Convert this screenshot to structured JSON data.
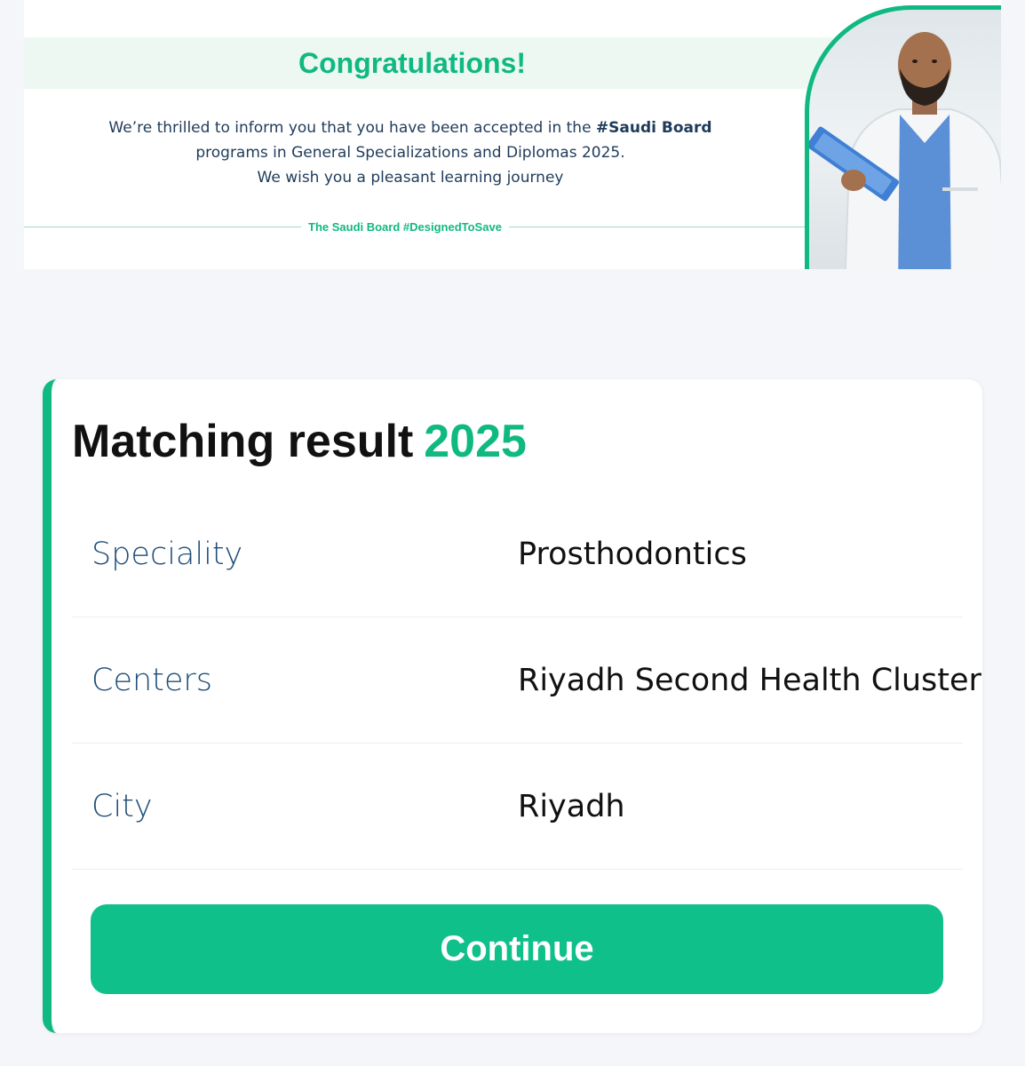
{
  "banner": {
    "title": "Congratulations!",
    "message_line1_prefix": "We’re thrilled to inform you that you have been accepted in the",
    "message_line1_highlight": "#Saudi Board",
    "message_line2": "programs in General Specializations and Diplomas 2025.",
    "message_line3": "We wish you a pleasant learning journey",
    "tagline": "The Saudi Board #DesignedToSave"
  },
  "result": {
    "title": "Matching result",
    "year": "2025",
    "rows": [
      {
        "label": "Speciality",
        "value": "Prosthodontics"
      },
      {
        "label": "Centers",
        "value": "Riyadh Second Health Cluster"
      },
      {
        "label": "City",
        "value": "Riyadh"
      }
    ],
    "continue_label": "Continue"
  },
  "colors": {
    "accent": "#10b981",
    "button": "#10c08b",
    "label": "#1f4e79",
    "background": "#f5f6fa"
  }
}
